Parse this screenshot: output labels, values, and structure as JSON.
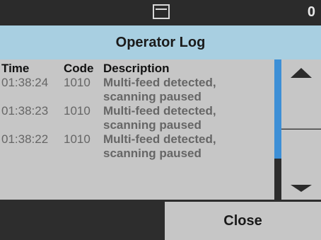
{
  "status": {
    "icon": "scanner-tray-icon",
    "count": "0"
  },
  "title": "Operator Log",
  "log": {
    "headers": {
      "time": "Time",
      "code": "Code",
      "description": "Description"
    },
    "entries": [
      {
        "time": "01:38:24",
        "code": "1010",
        "description_line1": "Multi-feed detected,",
        "description_line2": "scanning paused"
      },
      {
        "time": "01:38:23",
        "code": "1010",
        "description_line1": "Multi-feed detected,",
        "description_line2": "scanning paused"
      },
      {
        "time": "01:38:22",
        "code": "1010",
        "description_line1": "Multi-feed detected,",
        "description_line2": "scanning paused"
      }
    ]
  },
  "scroll": {
    "up_icon": "arrow-up-icon",
    "down_icon": "arrow-down-icon",
    "thumb_color": "#3d8fd6"
  },
  "buttons": {
    "close_label": "Close"
  },
  "colors": {
    "title_bar": "#a8cfe1",
    "panel": "#c6c6c6",
    "background": "#2d2d2d"
  }
}
